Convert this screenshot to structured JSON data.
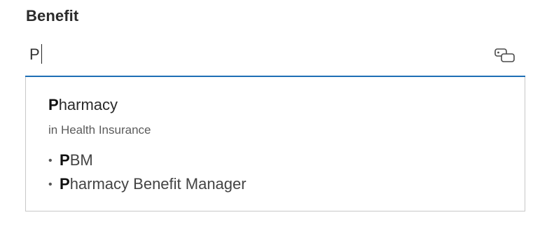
{
  "field": {
    "label": "Benefit",
    "input_value": "P",
    "icon": "term-tag-icon"
  },
  "suggestion": {
    "match_prefix": "P",
    "term_rest": "harmacy",
    "context": "in Health Insurance",
    "aliases": [
      {
        "match_prefix": "P",
        "rest": "BM"
      },
      {
        "match_prefix": "P",
        "rest": "harmacy Benefit Manager"
      }
    ]
  }
}
